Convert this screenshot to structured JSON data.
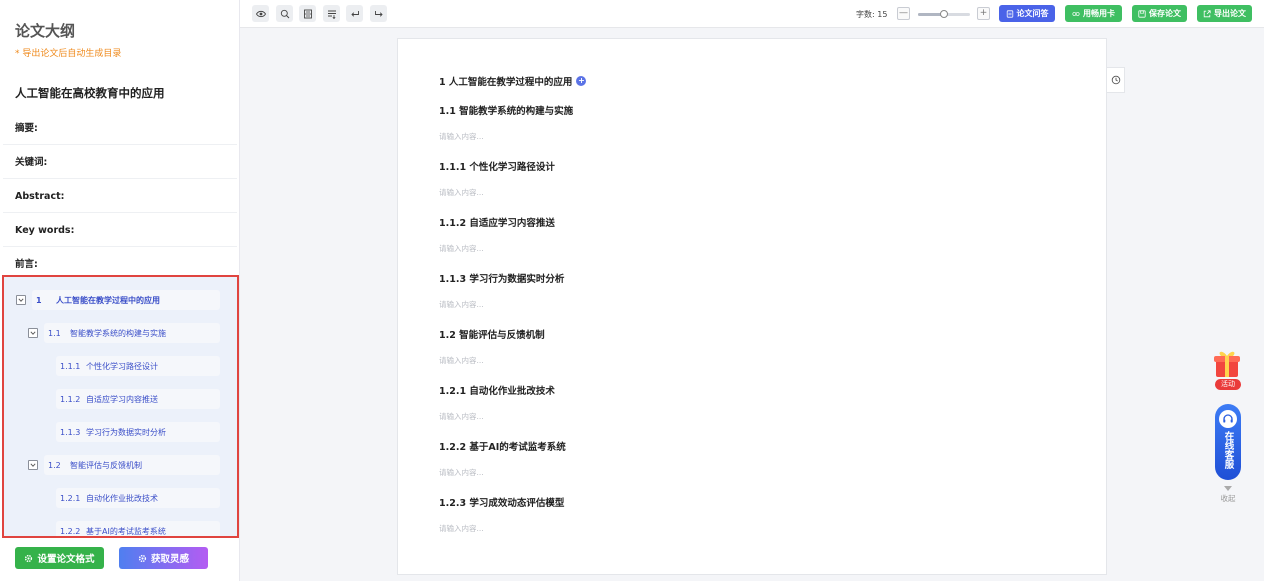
{
  "sidebar": {
    "title": "论文大纲",
    "hint": "* 导出论文后自动生成目录",
    "paper_title": "人工智能在高校教育中的应用",
    "sections": [
      "摘要:",
      "关键词:",
      "Abstract:",
      "Key words:",
      "前言:"
    ],
    "outline": [
      {
        "num": "1",
        "label": "人工智能在教学过程中的应用",
        "level": 1,
        "toggle": true
      },
      {
        "num": "1.1",
        "label": "智能教学系统的构建与实施",
        "level": 2,
        "toggle": true
      },
      {
        "num": "1.1.1",
        "label": "个性化学习路径设计",
        "level": 3,
        "toggle": false
      },
      {
        "num": "1.1.2",
        "label": "自适应学习内容推送",
        "level": 3,
        "toggle": false
      },
      {
        "num": "1.1.3",
        "label": "学习行为数据实时分析",
        "level": 3,
        "toggle": false
      },
      {
        "num": "1.2",
        "label": "智能评估与反馈机制",
        "level": 2,
        "toggle": true
      },
      {
        "num": "1.2.1",
        "label": "自动化作业批改技术",
        "level": 3,
        "toggle": false
      },
      {
        "num": "1.2.2",
        "label": "基于AI的考试监考系统",
        "level": 3,
        "toggle": false
      }
    ],
    "btn_format": "设置论文格式",
    "btn_inspire": "获取灵感"
  },
  "toolbar": {
    "icons": [
      "eye-icon",
      "zoom-icon",
      "layout-icon",
      "list-icon",
      "undo-icon",
      "redo-icon"
    ],
    "word_count_label": "字数: 15",
    "zoom_minus": "—",
    "zoom_plus": "+",
    "zoom_level": 0.5,
    "btn_qa": "论文问答",
    "btn_card": "用畅用卡",
    "btn_save": "保存论文",
    "btn_export": "导出论文"
  },
  "document": {
    "blocks": [
      {
        "heading": "1 人工智能在教学过程中的应用",
        "h1": true,
        "placeholder": ""
      },
      {
        "heading": "1.1 智能教学系统的构建与实施",
        "placeholder": "请输入内容..."
      },
      {
        "heading": "1.1.1 个性化学习路径设计",
        "placeholder": "请输入内容..."
      },
      {
        "heading": "1.1.2 自适应学习内容推送",
        "placeholder": "请输入内容..."
      },
      {
        "heading": "1.1.3 学习行为数据实时分析",
        "placeholder": "请输入内容..."
      },
      {
        "heading": "1.2 智能评估与反馈机制",
        "placeholder": "请输入内容..."
      },
      {
        "heading": "1.2.1 自动化作业批改技术",
        "placeholder": "请输入内容..."
      },
      {
        "heading": "1.2.2 基于AI的考试监考系统",
        "placeholder": "请输入内容..."
      },
      {
        "heading": "1.2.3 学习成效动态评估模型",
        "placeholder": "请输入内容..."
      }
    ],
    "plus_badge": "+"
  },
  "floating": {
    "gift_tag": "活动",
    "service_label": "在线客服",
    "collapse_label": "收起"
  },
  "colors": {
    "primary": "#4a63e8",
    "green": "#3fbf62",
    "highlight_border": "#e0443f",
    "outline_text": "#3a4ec8",
    "hint": "#ef8a1c"
  }
}
